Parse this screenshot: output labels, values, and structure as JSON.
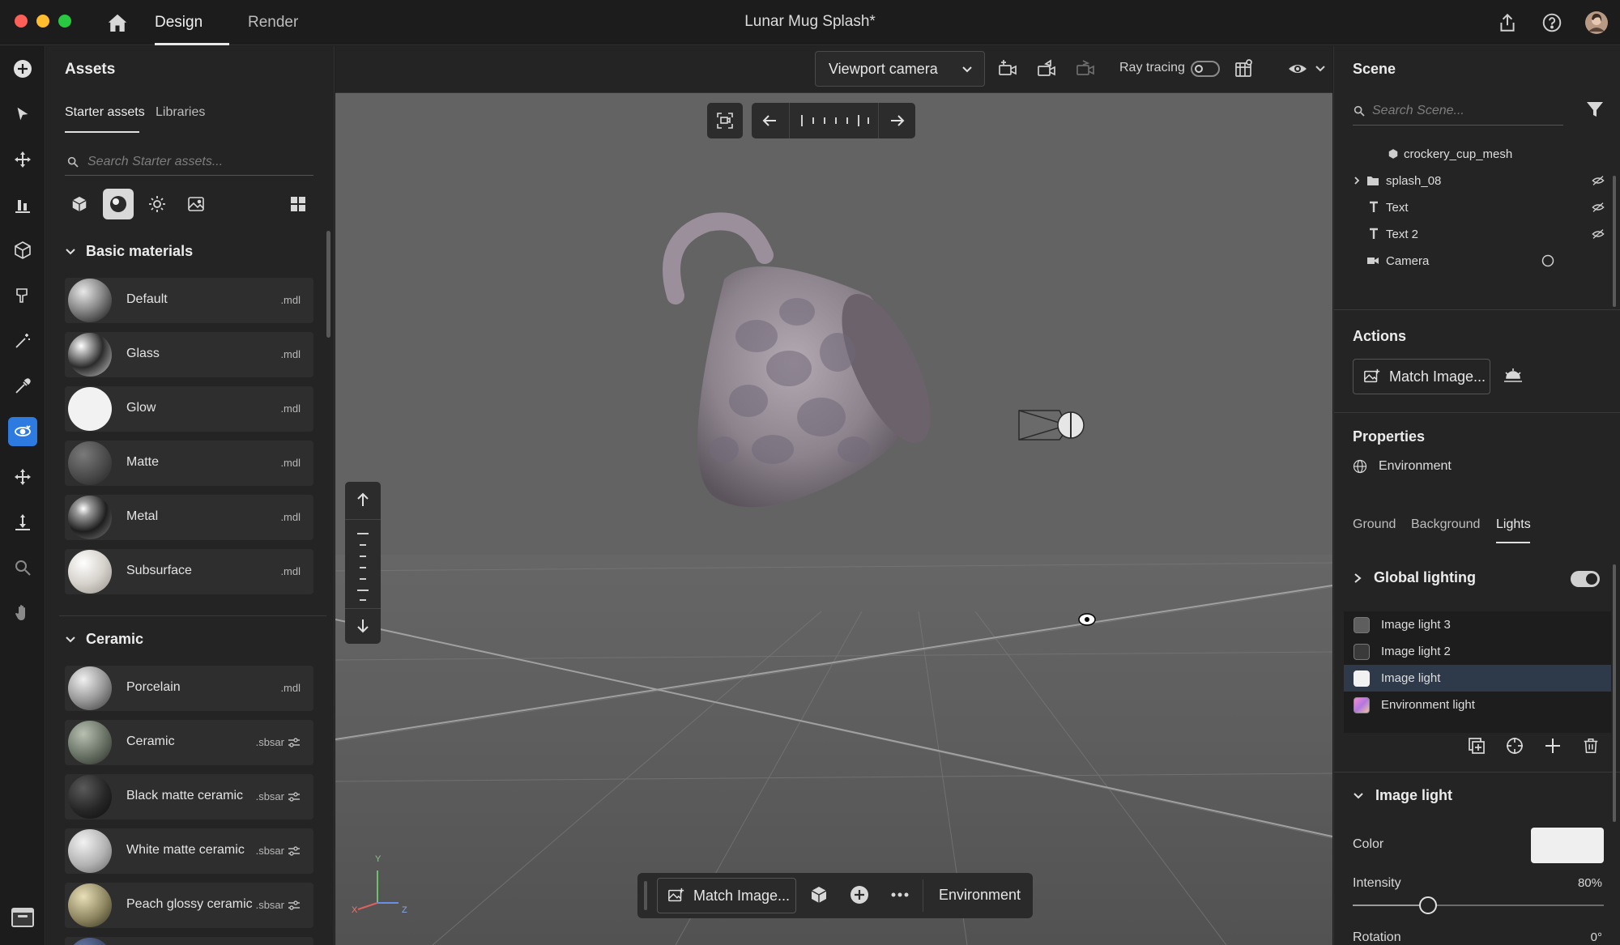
{
  "window": {
    "document_title": "Lunar Mug Splash*",
    "tabs": [
      {
        "label": "Design",
        "active": true
      },
      {
        "label": "Render",
        "active": false
      }
    ]
  },
  "left_toolbar": {
    "tools": [
      "add-icon",
      "select-icon",
      "move-icon",
      "align-icon",
      "model-icon",
      "paint-icon",
      "magic-wand-icon",
      "eyedropper-icon",
      "orbit-icon",
      "pan-icon",
      "drop-to-ground-icon",
      "zoom-icon",
      "hand-icon"
    ],
    "active_tool": "orbit-icon"
  },
  "assets": {
    "title": "Assets",
    "tabs": [
      {
        "label": "Starter assets",
        "active": true
      },
      {
        "label": "Libraries",
        "active": false
      }
    ],
    "search_placeholder": "Search Starter assets...",
    "filters": [
      "models-icon",
      "materials-icon",
      "lights-icon",
      "images-icon"
    ],
    "active_filter": "materials-icon",
    "sections": [
      {
        "title": "Basic materials",
        "items": [
          {
            "name": "Default",
            "ext": ".mdl"
          },
          {
            "name": "Glass",
            "ext": ".mdl"
          },
          {
            "name": "Glow",
            "ext": ".mdl"
          },
          {
            "name": "Matte",
            "ext": ".mdl"
          },
          {
            "name": "Metal",
            "ext": ".mdl"
          },
          {
            "name": "Subsurface",
            "ext": ".mdl"
          }
        ]
      },
      {
        "title": "Ceramic",
        "items": [
          {
            "name": "Porcelain",
            "ext": ".mdl"
          },
          {
            "name": "Ceramic",
            "ext": ".sbsar"
          },
          {
            "name": "Black matte ceramic",
            "ext": ".sbsar"
          },
          {
            "name": "White matte ceramic",
            "ext": ".sbsar"
          },
          {
            "name": "Peach glossy ceramic",
            "ext": ".sbsar"
          }
        ]
      }
    ]
  },
  "viewport": {
    "camera_select": "Viewport camera",
    "ray_tracing_label": "Ray tracing",
    "ray_tracing_on": false,
    "bottom_bar": {
      "match_image_label": "Match Image...",
      "environment_label": "Environment"
    },
    "axis_labels": {
      "x": "X",
      "y": "Y",
      "z": "Z"
    }
  },
  "scene": {
    "title": "Scene",
    "search_placeholder": "Search Scene...",
    "items": [
      {
        "label": "crockery_cup_mesh",
        "icon": "mesh-icon",
        "indent": 2,
        "expandable": false,
        "visibility": "none"
      },
      {
        "label": "splash_08",
        "icon": "folder-icon",
        "indent": 1,
        "expandable": true,
        "visibility": "hidden"
      },
      {
        "label": "Text",
        "icon": "text-icon",
        "indent": 1,
        "expandable": false,
        "visibility": "hidden"
      },
      {
        "label": "Text 2",
        "icon": "text-icon",
        "indent": 1,
        "expandable": false,
        "visibility": "hidden"
      },
      {
        "label": "Camera",
        "icon": "camera-icon",
        "indent": 1,
        "expandable": false,
        "visibility": "radio"
      }
    ]
  },
  "actions": {
    "title": "Actions",
    "match_image_label": "Match Image..."
  },
  "properties": {
    "title": "Properties",
    "selection": "Environment",
    "tabs": [
      {
        "label": "Ground",
        "active": false
      },
      {
        "label": "Background",
        "active": false
      },
      {
        "label": "Lights",
        "active": true
      }
    ],
    "global_lighting_label": "Global lighting",
    "global_lighting_on": true,
    "lights": [
      {
        "label": "Image light 3",
        "swatch": "#5e5e5e",
        "selected": false
      },
      {
        "label": "Image light 2",
        "swatch": "#3a3a3a",
        "selected": false
      },
      {
        "label": "Image light",
        "swatch": "#f2f2f2",
        "selected": true
      },
      {
        "label": "Environment light",
        "swatch": "gradient",
        "selected": false
      }
    ],
    "image_light": {
      "title": "Image light",
      "color_label": "Color",
      "color_value": "#efefef",
      "intensity_label": "Intensity",
      "intensity_value": "80%",
      "intensity_fraction": 0.3,
      "rotation_label": "Rotation",
      "rotation_value": "0°"
    }
  },
  "colors": {
    "accent": "#2d7be0",
    "panel": "#242424",
    "viewport": "#606060"
  }
}
